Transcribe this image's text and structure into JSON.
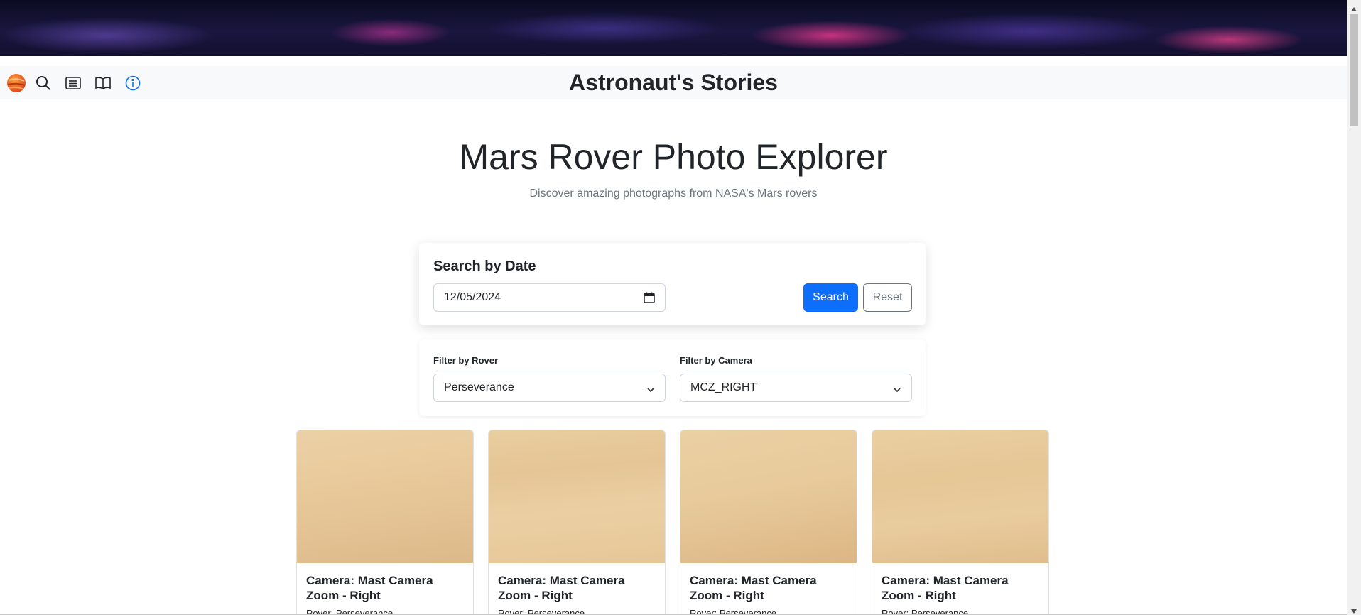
{
  "nav": {
    "title": "Astronaut's Stories",
    "icons": [
      "mars-planet-icon",
      "search-icon",
      "list-icon",
      "book-icon",
      "info-icon"
    ]
  },
  "hero": {
    "title": "Mars Rover Photo Explorer",
    "subtitle": "Discover amazing photographs from NASA's Mars rovers"
  },
  "search": {
    "heading": "Search by Date",
    "date_value": "12/05/2024",
    "search_label": "Search",
    "reset_label": "Reset"
  },
  "filters": {
    "rover_label": "Filter by Rover",
    "rover_value": "Perseverance",
    "camera_label": "Filter by Camera",
    "camera_value": "MCZ_RIGHT"
  },
  "photos": [
    {
      "title": "Camera: Mast Camera Zoom - Right",
      "rover": "Rover: Perseverance"
    },
    {
      "title": "Camera: Mast Camera Zoom - Right",
      "rover": "Rover: Perseverance"
    },
    {
      "title": "Camera: Mast Camera Zoom - Right",
      "rover": "Rover: Perseverance"
    },
    {
      "title": "Camera: Mast Camera Zoom - Right",
      "rover": "Rover: Perseverance"
    }
  ],
  "colors": {
    "primary": "#0d6efd",
    "info_icon": "#0d6efd",
    "navbar_bg": "#f8f9fa",
    "mars_sand": "#e8c99a"
  }
}
